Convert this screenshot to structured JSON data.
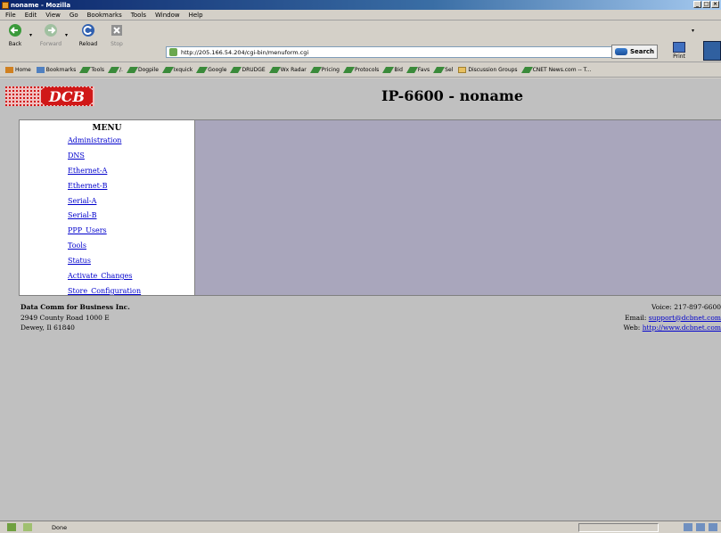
{
  "window": {
    "title": "noname - Mozilla"
  },
  "menubar": [
    "File",
    "Edit",
    "View",
    "Go",
    "Bookmarks",
    "Tools",
    "Window",
    "Help"
  ],
  "nav": {
    "back": "Back",
    "forward": "Forward",
    "reload": "Reload",
    "stop": "Stop",
    "url": "http://205.166.54.204/cgi-bin/menuform.cgi",
    "search": "Search",
    "print": "Print"
  },
  "bookmarks": [
    "Home",
    "Bookmarks",
    "Tools",
    "/.",
    "Dogpile",
    "Ixquick",
    "Google",
    "DRUDGE",
    "Wx Radar",
    "Pricing",
    "Protocols",
    "Bid",
    "Favs",
    "Sel",
    "Discussion Groups",
    "CNET News.com -- T..."
  ],
  "page": {
    "logo_text": "DCB",
    "title": "IP-6600 - noname",
    "menu_heading": "MENU",
    "menu_items": [
      "Administration",
      "DNS",
      "Ethernet-A",
      "Ethernet-B",
      "Serial-A",
      "Serial-B",
      "PPP_Users",
      "Tools",
      "Status",
      "Activate_Changes",
      "Store_Configuration"
    ]
  },
  "footer": {
    "company": "Data Comm for Business Inc.",
    "address1": "2949 County Road 1000 E",
    "address2": "Dewey, Il 61840",
    "voice": "Voice: 217-897-6600",
    "email_label": "Email: ",
    "email": "support@dcbnet.com",
    "web_label": "Web: ",
    "web": "http://www.dcbnet.com"
  },
  "status": {
    "text": "Done"
  },
  "colors": {
    "main_panel": "#a9a6bc",
    "link": "#0000cc",
    "logo_red": "#d01818"
  }
}
